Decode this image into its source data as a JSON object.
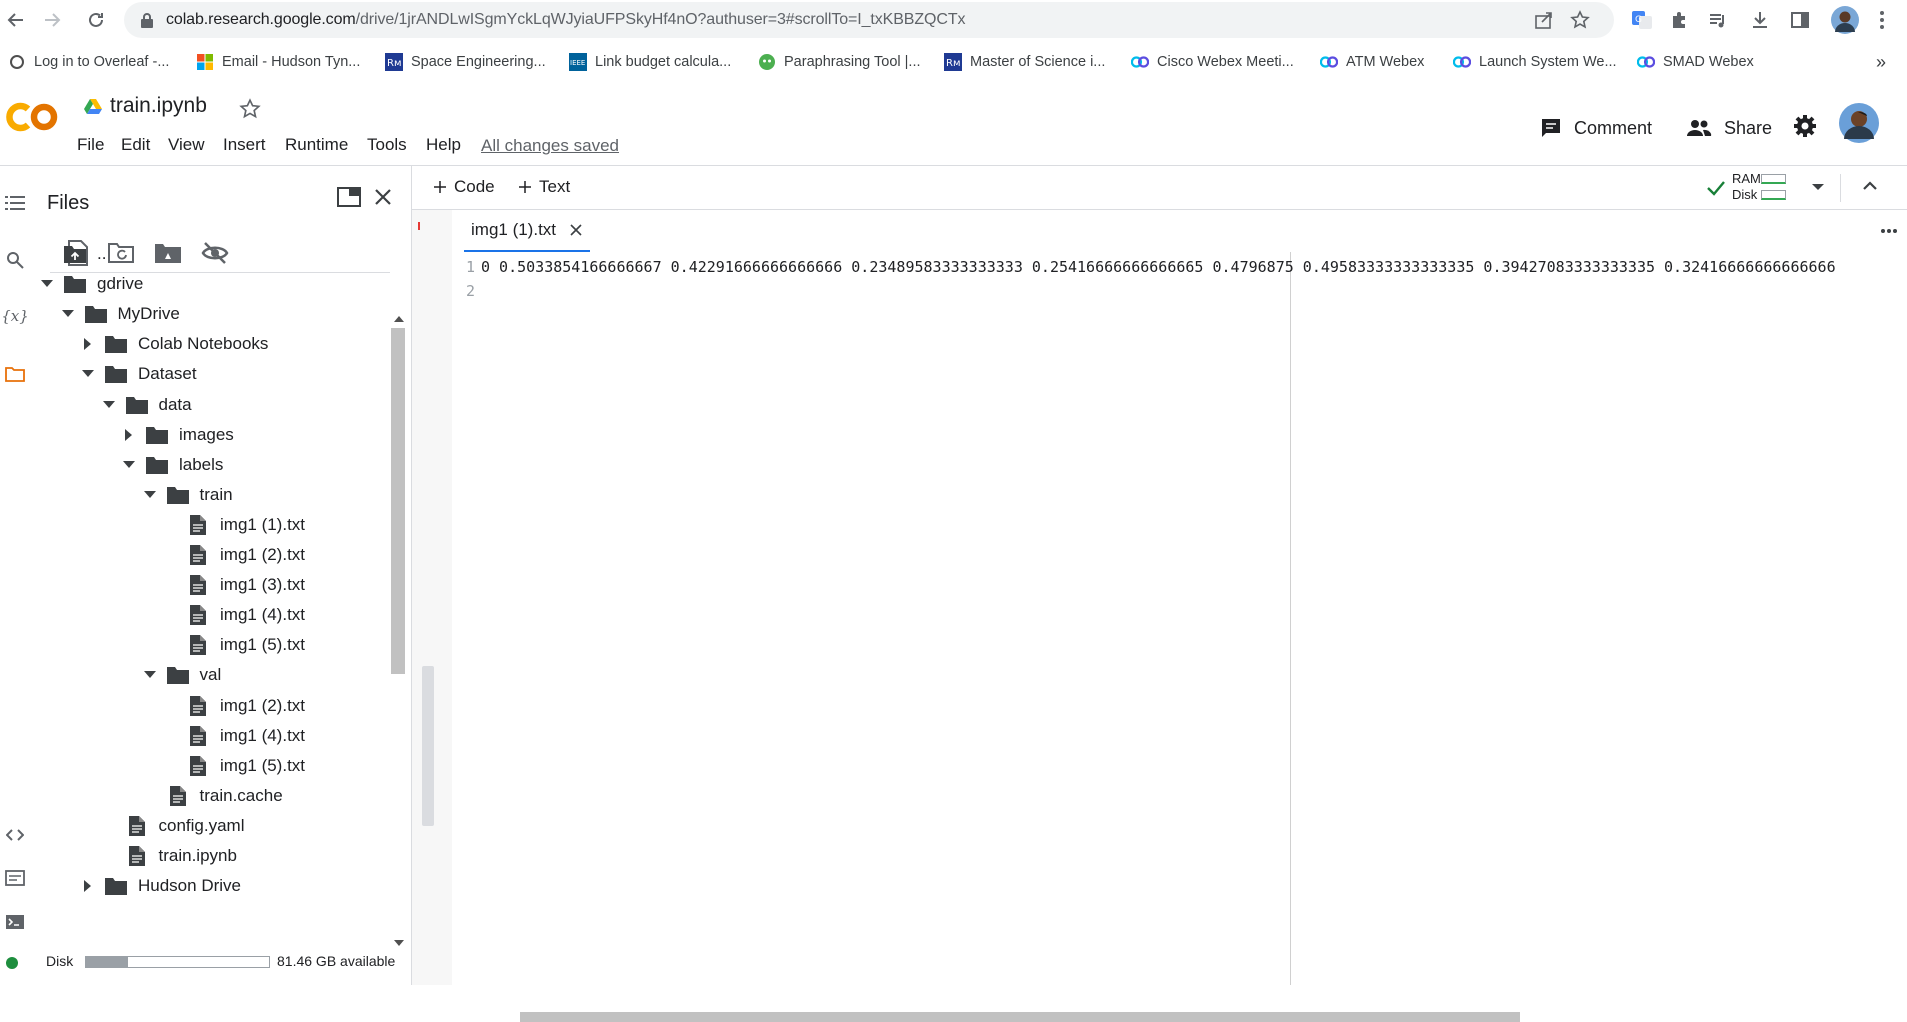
{
  "browser": {
    "url_host": "colab.research.google.com",
    "url_path": "/drive/1jrANDLwISgmYckLqWJyiaUFPSkyHf4nO?authuser=3#scrollTo=I_txKBBZQCTx",
    "bookmarks": [
      {
        "label": "Log in to Overleaf -...",
        "icon": "overleaf-icon"
      },
      {
        "label": "Email - Hudson Tyn...",
        "icon": "microsoft-icon"
      },
      {
        "label": "Space Engineering...",
        "icon": "rm-icon"
      },
      {
        "label": "Link budget calcula...",
        "icon": "ieee-icon"
      },
      {
        "label": "Paraphrasing Tool |...",
        "icon": "paraphrase-icon"
      },
      {
        "label": "Master of Science i...",
        "icon": "rm-icon"
      },
      {
        "label": "Cisco Webex Meeti...",
        "icon": "webex-icon"
      },
      {
        "label": "ATM Webex",
        "icon": "webex-icon"
      },
      {
        "label": "Launch System We...",
        "icon": "webex-icon"
      },
      {
        "label": "SMAD Webex",
        "icon": "webex-icon"
      }
    ],
    "more_bookmarks": "»"
  },
  "colab": {
    "logo": "CO",
    "notebook_title": "train.ipynb",
    "menu": [
      "File",
      "Edit",
      "View",
      "Insert",
      "Runtime",
      "Tools",
      "Help"
    ],
    "save_status": "All changes saved",
    "comment_label": "Comment",
    "share_label": "Share"
  },
  "files": {
    "title": "Files",
    "tree": [
      {
        "label": "..",
        "type": "up",
        "depth": 0,
        "caret": "none"
      },
      {
        "label": "gdrive",
        "type": "folder",
        "depth": 0,
        "caret": "open"
      },
      {
        "label": "MyDrive",
        "type": "folder",
        "depth": 1,
        "caret": "open"
      },
      {
        "label": "Colab Notebooks",
        "type": "folder",
        "depth": 2,
        "caret": "closed"
      },
      {
        "label": "Dataset",
        "type": "folder",
        "depth": 2,
        "caret": "open"
      },
      {
        "label": "data",
        "type": "folder",
        "depth": 3,
        "caret": "open"
      },
      {
        "label": "images",
        "type": "folder",
        "depth": 4,
        "caret": "closed"
      },
      {
        "label": "labels",
        "type": "folder",
        "depth": 4,
        "caret": "open"
      },
      {
        "label": "train",
        "type": "folder",
        "depth": 5,
        "caret": "open"
      },
      {
        "label": "img1 (1).txt",
        "type": "file",
        "depth": 6,
        "caret": "none"
      },
      {
        "label": "img1 (2).txt",
        "type": "file",
        "depth": 6,
        "caret": "none"
      },
      {
        "label": "img1 (3).txt",
        "type": "file",
        "depth": 6,
        "caret": "none"
      },
      {
        "label": "img1 (4).txt",
        "type": "file",
        "depth": 6,
        "caret": "none"
      },
      {
        "label": "img1 (5).txt",
        "type": "file",
        "depth": 6,
        "caret": "none"
      },
      {
        "label": "val",
        "type": "folder",
        "depth": 5,
        "caret": "open"
      },
      {
        "label": "img1 (2).txt",
        "type": "file",
        "depth": 6,
        "caret": "none"
      },
      {
        "label": "img1 (4).txt",
        "type": "file",
        "depth": 6,
        "caret": "none"
      },
      {
        "label": "img1 (5).txt",
        "type": "file",
        "depth": 6,
        "caret": "none"
      },
      {
        "label": "train.cache",
        "type": "file",
        "depth": 5,
        "caret": "none"
      },
      {
        "label": "config.yaml",
        "type": "file",
        "depth": 3,
        "caret": "none"
      },
      {
        "label": "train.ipynb",
        "type": "file",
        "depth": 3,
        "caret": "none"
      },
      {
        "label": "Hudson Drive",
        "type": "folder",
        "depth": 2,
        "caret": "closed"
      }
    ],
    "disk_label": "Disk",
    "disk_available": "81.46 GB available",
    "disk_fraction": 0.23
  },
  "toolbar": {
    "add_code": "Code",
    "add_text": "Text",
    "ram_label": "RAM",
    "disk_label": "Disk"
  },
  "editor": {
    "tab_label": "img1 (1).txt",
    "lines": [
      {
        "num": "1",
        "text": "0 0.5033854166666667 0.42291666666666666 0.23489583333333333 0.25416666666666665 0.4796875 0.49583333333333335 0.39427083333333335 0.32416666666666666"
      },
      {
        "num": "2",
        "text": ""
      }
    ]
  }
}
